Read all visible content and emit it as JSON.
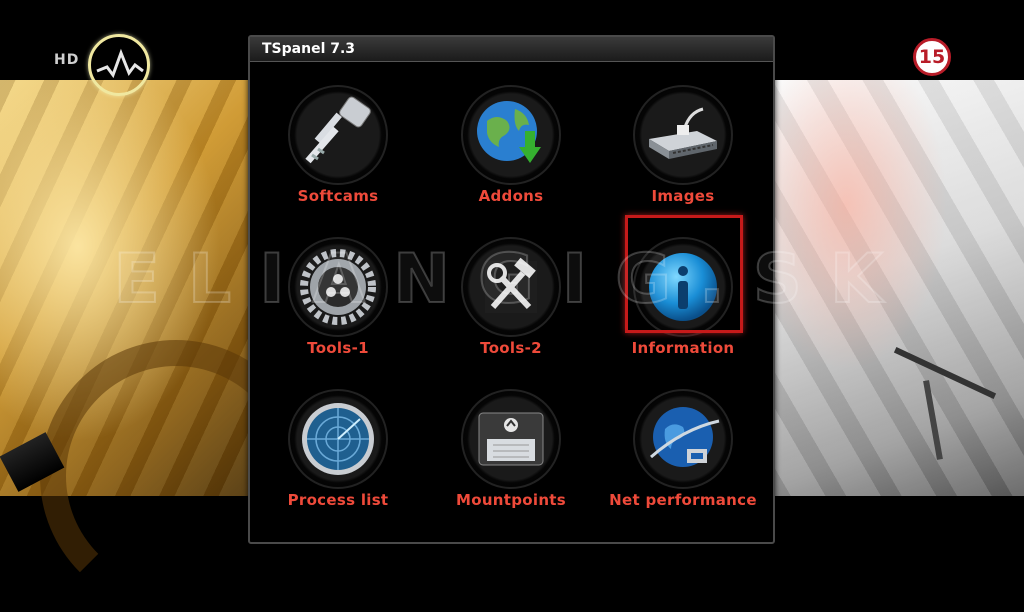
{
  "overlay": {
    "hd_label": "HD",
    "age_rating": "15",
    "watermark": "ELIANGIG.SK"
  },
  "panel": {
    "title": "TSpanel 7.3",
    "selected_index": 5,
    "items": [
      {
        "label": "Softcams",
        "icon": "key-icon"
      },
      {
        "label": "Addons",
        "icon": "globe-download-icon"
      },
      {
        "label": "Images",
        "icon": "network-switch-icon"
      },
      {
        "label": "Tools-1",
        "icon": "gear-icon"
      },
      {
        "label": "Tools-2",
        "icon": "hammer-wrench-icon"
      },
      {
        "label": "Information",
        "icon": "info-icon"
      },
      {
        "label": "Process list",
        "icon": "radar-icon"
      },
      {
        "label": "Mountpoints",
        "icon": "drive-mount-icon"
      },
      {
        "label": "Net performance",
        "icon": "globe-network-icon"
      }
    ]
  },
  "colors": {
    "label": "#ee4a3a",
    "selection": "#c61a1a",
    "title_text": "#ffffff"
  }
}
